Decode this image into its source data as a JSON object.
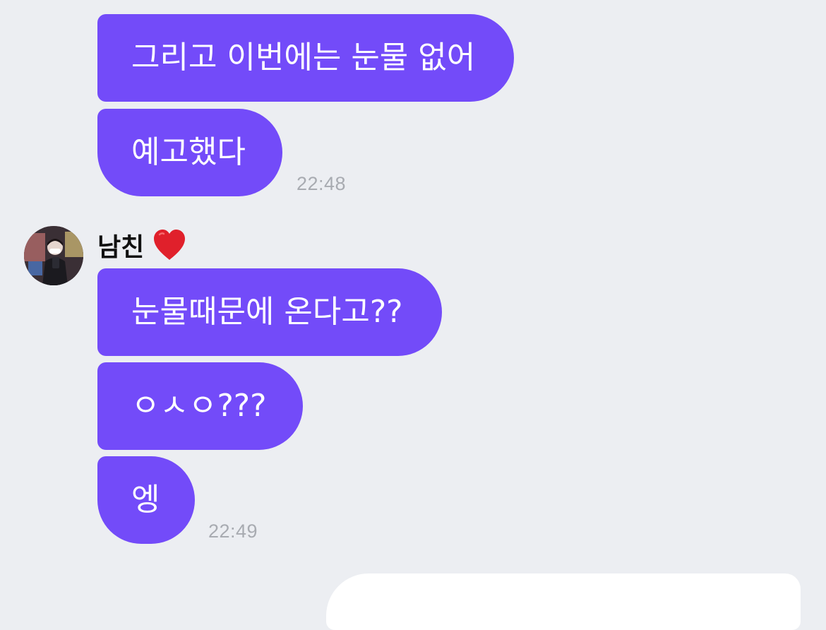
{
  "messages": {
    "group1": [
      {
        "text": "그리고 이번에는 눈물 없어"
      },
      {
        "text": "예고했다"
      }
    ],
    "group1_time": "22:48",
    "sender": {
      "name": "남친",
      "emoji": "heart-emoji"
    },
    "group2": [
      {
        "text": "눈물때문에 온다고??"
      },
      {
        "text": "ㅇㅅㅇ???"
      },
      {
        "text": "엥"
      }
    ],
    "group2_time": "22:49"
  },
  "colors": {
    "background": "#ECEEF2",
    "bubble": "#734BF9",
    "bubble_text": "#FFFFFF",
    "timestamp": "#A8ABB1",
    "heart": "#E0202B"
  }
}
